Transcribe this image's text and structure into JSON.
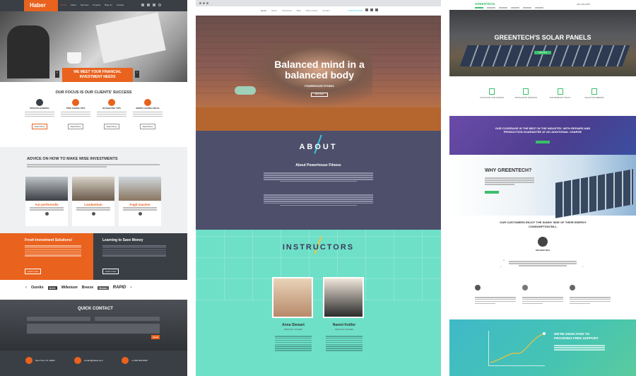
{
  "col1": {
    "logo": "Haber",
    "nav": [
      "Home",
      "About",
      "Services",
      "Projects",
      "Blog Us",
      "Contact"
    ],
    "hero_banner": "We meet your financial investment needs",
    "focus_title": "Our focus is our clients' success",
    "features": [
      {
        "label": "Private Banking"
      },
      {
        "label": "Time Saving Tips"
      },
      {
        "label": "Budgeting Tips"
      },
      {
        "label": "Money Saving Ideas"
      }
    ],
    "read_more": "Read More",
    "advice_title": "Advice on how to make wise investments",
    "team": [
      {
        "name": "Aut perferendis"
      },
      {
        "name": "Laudantium"
      },
      {
        "name": "Fugit maxime"
      }
    ],
    "solutions_title": "Fresh Investment Solutions!",
    "save_title": "Learning to Save Money",
    "learn_more": "Learn more",
    "partners": [
      "Ourelio",
      "DOG",
      "Millenium",
      "Breeze",
      "Green",
      "RAPID"
    ],
    "contact_title": "Quick Contact",
    "send_label": "Send",
    "footer": [
      {
        "text": "New York, NY 10022"
      },
      {
        "text": "contact@haber.com"
      },
      {
        "text": "+1 800 903 9039"
      }
    ],
    "colors": {
      "orange": "#e9621e",
      "dark": "#3a3f45"
    }
  },
  "col2": {
    "nav": [
      "Home",
      "About",
      "Instructors",
      "Blog",
      "Book Online",
      "Contact"
    ],
    "phone": "1-800-000-0000",
    "hero_title": "Balanced mind in a balanced body",
    "hero_sub": "Powerhouse Fitness",
    "hero_btn": "Book Now",
    "about_title": "ABOUT",
    "about_sub": "About Powerhouse Fitness",
    "instructors_title": "INSTRUCTORS",
    "instructors": [
      {
        "name": "Anna Stewart",
        "role": "Personal Trainer"
      },
      {
        "name": "Naomi Kettler",
        "role": "Personal Trainer"
      }
    ],
    "colors": {
      "navy": "#4e4f6b",
      "mint": "#6fe0c8",
      "accent": "#36c7e0"
    }
  },
  "col3": {
    "logo": "GREENTECH",
    "phone": "(01) 234-5678",
    "hero_title": "GREENTECH'S SOLAR PANELS",
    "hero_btn": "Learn More",
    "features": [
      "Calculate your savings",
      "Installation Hands-on",
      "Our Warranty Policy",
      "Qualifying Rebates"
    ],
    "coverage_text": "Our coverage is the best in the industry, with repairs and production guarantee at no additional charge",
    "why_title": "WHY GREENTECH?",
    "customers_text": "Our customers enjoy the sunny side of their energy consumption bill.",
    "testimonial_name": "Orlando Rich",
    "dedicated_title": "We're dedicated to providing free support",
    "colors": {
      "green": "#3bbf6a",
      "purple": "#5a4a9a",
      "teal": "#3fb9c8"
    }
  }
}
